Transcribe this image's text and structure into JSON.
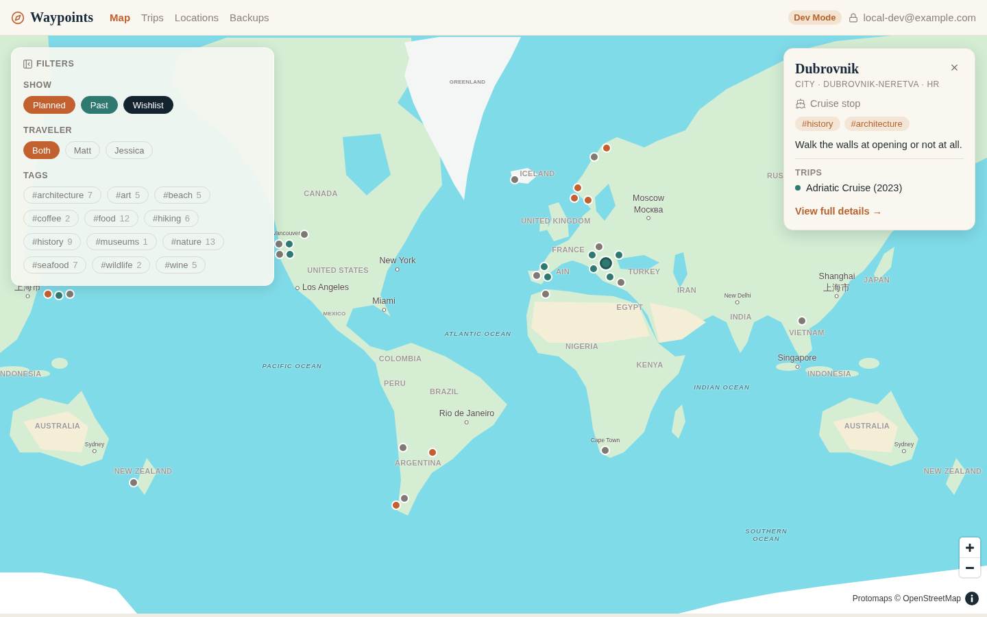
{
  "header": {
    "app_name": "Waypoints",
    "nav": [
      {
        "label": "Map",
        "selected": true
      },
      {
        "label": "Trips",
        "selected": false
      },
      {
        "label": "Locations",
        "selected": false
      },
      {
        "label": "Backups",
        "selected": false
      }
    ],
    "mode_badge": "Dev Mode",
    "user_email": "local-dev@example.com"
  },
  "filters": {
    "title": "FILTERS",
    "show": {
      "label": "SHOW",
      "options": [
        {
          "label": "Planned",
          "selected": true,
          "color": "#c2612f"
        },
        {
          "label": "Past",
          "selected": true,
          "color": "#2e7a71"
        },
        {
          "label": "Wishlist",
          "selected": true,
          "color": "#13242f"
        }
      ]
    },
    "traveler": {
      "label": "TRAVELER",
      "options": [
        {
          "label": "Both",
          "selected": true
        },
        {
          "label": "Matt",
          "selected": false
        },
        {
          "label": "Jessica",
          "selected": false
        }
      ]
    },
    "tags": {
      "label": "TAGS",
      "items": [
        {
          "name": "#architecture",
          "count": "7",
          "selected": false
        },
        {
          "name": "#art",
          "count": "5",
          "selected": false
        },
        {
          "name": "#beach",
          "count": "5",
          "selected": false
        },
        {
          "name": "#coffee",
          "count": "2",
          "selected": false
        },
        {
          "name": "#food",
          "count": "12",
          "selected": false
        },
        {
          "name": "#hiking",
          "count": "6",
          "selected": false
        },
        {
          "name": "#history",
          "count": "9",
          "selected": false
        },
        {
          "name": "#museums",
          "count": "1",
          "selected": false
        },
        {
          "name": "#nature",
          "count": "13",
          "selected": false
        },
        {
          "name": "#seafood",
          "count": "7",
          "selected": false
        },
        {
          "name": "#wildlife",
          "count": "2",
          "selected": false
        },
        {
          "name": "#wine",
          "count": "5",
          "selected": false
        }
      ]
    }
  },
  "popup": {
    "title": "Dubrovnik",
    "subtitle": "CITY · DUBROVNIK-NERETVA · HR",
    "category": "Cruise stop",
    "tags": [
      "#history",
      "#architecture"
    ],
    "note": "Walk the walls at opening or not at all.",
    "trips_label": "TRIPS",
    "trips": [
      {
        "name": "Adriatic Cruise (2023)",
        "color": "#2e7a71"
      }
    ],
    "link": "View full details →"
  },
  "map": {
    "labels": [
      {
        "text": "GREENLAND",
        "kind": "territory"
      },
      {
        "text": "ICELAND",
        "kind": "country"
      },
      {
        "text": "RUS",
        "kind": "country"
      },
      {
        "text": "CANADA",
        "kind": "country"
      },
      {
        "text": "Moscow",
        "local_name": "Москва",
        "kind": "city"
      },
      {
        "text": "UNITED KINGDOM",
        "kind": "country"
      },
      {
        "text": "Vancouver",
        "kind": "town"
      },
      {
        "text": "FRANCE",
        "kind": "country"
      },
      {
        "text": "New York",
        "kind": "city"
      },
      {
        "text": "UNITED STATES",
        "kind": "country"
      },
      {
        "text": "AIN",
        "kind": "country"
      },
      {
        "text": "TURKEY",
        "kind": "country"
      },
      {
        "text": "Shanghai",
        "local_name": "上海市",
        "kind": "city"
      },
      {
        "text": "JAPAN",
        "kind": "country"
      },
      {
        "text": "上海市",
        "kind": "city"
      },
      {
        "text": "Los Angeles",
        "kind": "city"
      },
      {
        "text": "IRAN",
        "kind": "country"
      },
      {
        "text": "New Delhi",
        "kind": "town"
      },
      {
        "text": "Miami",
        "kind": "city"
      },
      {
        "text": "EGYPT",
        "kind": "country"
      },
      {
        "text": "MEXICO",
        "kind": "territory"
      },
      {
        "text": "INDIA",
        "kind": "country"
      },
      {
        "text": "VIETNAM",
        "kind": "country"
      },
      {
        "text": "ATLANTIC OCEAN",
        "kind": "ocean"
      },
      {
        "text": "NIGERIA",
        "kind": "country"
      },
      {
        "text": "COLOMBIA",
        "kind": "country"
      },
      {
        "text": "Singapore",
        "kind": "city"
      },
      {
        "text": "PACIFIC OCEAN",
        "kind": "ocean"
      },
      {
        "text": "KENYA",
        "kind": "country"
      },
      {
        "text": "NDONESIA",
        "kind": "country"
      },
      {
        "text": "INDONESIA",
        "kind": "country"
      },
      {
        "text": "PERU",
        "kind": "country"
      },
      {
        "text": "INDIAN OCEAN",
        "kind": "ocean"
      },
      {
        "text": "BRAZIL",
        "kind": "country"
      },
      {
        "text": "Rio de Janeiro",
        "kind": "city"
      },
      {
        "text": "AUSTRALIA",
        "kind": "country"
      },
      {
        "text": "AUSTRALIA",
        "kind": "country"
      },
      {
        "text": "Sydney",
        "kind": "town"
      },
      {
        "text": "Cape Town",
        "kind": "town"
      },
      {
        "text": "Sydney",
        "kind": "town"
      },
      {
        "text": "ARGENTINA",
        "kind": "country"
      },
      {
        "text": "NEW ZEALAND",
        "kind": "country"
      },
      {
        "text": "NEW ZEALAND",
        "kind": "country"
      },
      {
        "text": "SOUTHERN OCEAN",
        "kind": "ocean"
      }
    ],
    "markers": [
      {
        "color": "#c2612f",
        "selected": false
      },
      {
        "color": "#7f7a74",
        "selected": false
      },
      {
        "color": "#7f7a74",
        "selected": false
      },
      {
        "color": "#c2612f",
        "selected": false
      },
      {
        "color": "#c2612f",
        "selected": false
      },
      {
        "color": "#c2612f",
        "selected": false
      },
      {
        "color": "#7f7a74",
        "selected": false
      },
      {
        "color": "#7f7a74",
        "selected": false
      },
      {
        "color": "#2e7a71",
        "selected": false
      },
      {
        "color": "#7f7a74",
        "selected": false
      },
      {
        "color": "#7f7a74",
        "selected": false
      },
      {
        "color": "#2e7a71",
        "selected": false
      },
      {
        "color": "#2e7a71",
        "selected": false
      },
      {
        "color": "#2e7a71",
        "selected": false
      },
      {
        "color": "#2e7a71",
        "selected": true
      },
      {
        "color": "#2e7a71",
        "selected": false
      },
      {
        "color": "#2e7a71",
        "selected": false
      },
      {
        "color": "#7f7a74",
        "selected": false
      },
      {
        "color": "#2e7a71",
        "selected": false
      },
      {
        "color": "#2e7a71",
        "selected": false
      },
      {
        "color": "#7f7a74",
        "selected": false
      },
      {
        "color": "#c2612f",
        "selected": false
      },
      {
        "color": "#2e7a71",
        "selected": false
      },
      {
        "color": "#7f7a74",
        "selected": false
      },
      {
        "color": "#7f7a74",
        "selected": false
      },
      {
        "color": "#7f7a74",
        "selected": false
      },
      {
        "color": "#7f7a74",
        "selected": false
      },
      {
        "color": "#7f7a74",
        "selected": false
      },
      {
        "color": "#c2612f",
        "selected": false
      },
      {
        "color": "#7f7a74",
        "selected": false
      },
      {
        "color": "#7f7a74",
        "selected": false
      },
      {
        "color": "#c2612f",
        "selected": false
      }
    ],
    "attribution": "Protomaps © OpenStreetMap"
  }
}
